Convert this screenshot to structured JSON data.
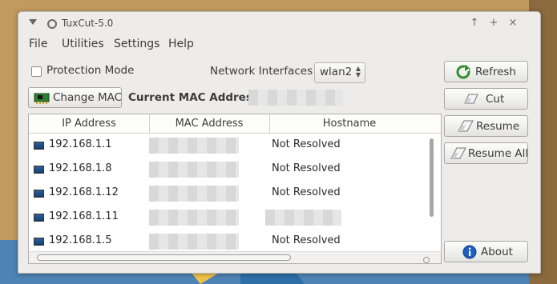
{
  "window": {
    "title": "TuxCut-5.0",
    "controls": [
      "↑",
      "+",
      "×"
    ]
  },
  "menubar": {
    "items": [
      "File",
      "Utilities",
      "Settings",
      "Help"
    ]
  },
  "options": {
    "protection_mode_label": "Protection Mode",
    "protection_mode_checked": false,
    "network_interfaces_label": "Network Interfaces :",
    "network_interface_value": "wlan2"
  },
  "mac": {
    "change_mac_label": "Change MAC",
    "current_mac_label": "Current MAC Address :"
  },
  "table": {
    "headers": [
      "IP Address",
      "MAC Address",
      "Hostname"
    ],
    "rows": [
      {
        "ip": "192.168.1.1",
        "hostname": "Not Resolved"
      },
      {
        "ip": "192.168.1.8",
        "hostname": "Not Resolved"
      },
      {
        "ip": "192.168.1.12",
        "hostname": "Not Resolved"
      },
      {
        "ip": "192.168.1.11",
        "hostname": ""
      },
      {
        "ip": "192.168.1.5",
        "hostname": "Not Resolved"
      }
    ]
  },
  "actions": {
    "refresh_label": "Refresh",
    "cut_label": "Cut",
    "resume_label": "Resume",
    "resume_all_label": "Resume All",
    "about_label": "About"
  },
  "icons": {
    "refresh": "refresh-icon",
    "cut": "eraser-icon",
    "resume": "eraser-icon",
    "resume_all": "eraser-icon",
    "about": "info-icon",
    "change_mac": "network-card-icon",
    "host": "computer-icon"
  },
  "colors": {
    "window_bg": "#edecea",
    "accent_green": "#2f8f2f",
    "info_blue": "#1f5fbf"
  }
}
